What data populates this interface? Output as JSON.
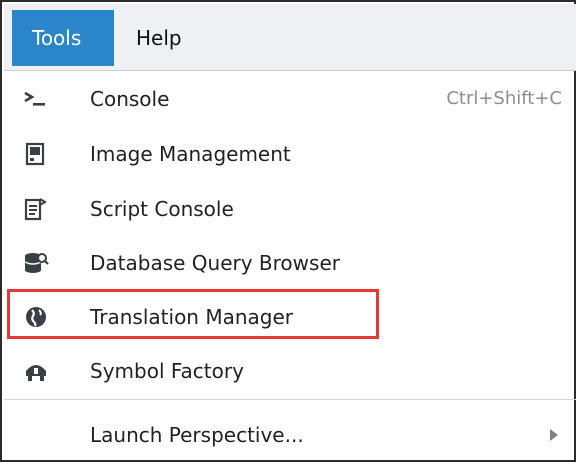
{
  "menubar": {
    "menus": [
      {
        "label": "Tools",
        "active": true
      },
      {
        "label": "Help",
        "active": false
      }
    ]
  },
  "tools_menu": {
    "items": [
      {
        "label": "Console",
        "shortcut": "Ctrl+Shift+C",
        "icon": "console-prompt-icon"
      },
      {
        "label": "Image Management",
        "icon": "image-management-icon"
      },
      {
        "label": "Script Console",
        "icon": "script-console-icon"
      },
      {
        "label": "Database Query Browser",
        "icon": "database-search-icon"
      },
      {
        "label": "Translation Manager",
        "icon": "globe-icon",
        "highlighted": true
      },
      {
        "label": "Symbol Factory",
        "icon": "symbol-factory-icon"
      },
      {
        "label": "Launch Perspective...",
        "icon": "chevron-right-icon",
        "has_submenu": true
      }
    ]
  },
  "colors": {
    "accent": "#2b86c9",
    "highlight_box": "#e53935",
    "menubar_bg": "#eef0f3",
    "icon": "#3a3f45"
  }
}
